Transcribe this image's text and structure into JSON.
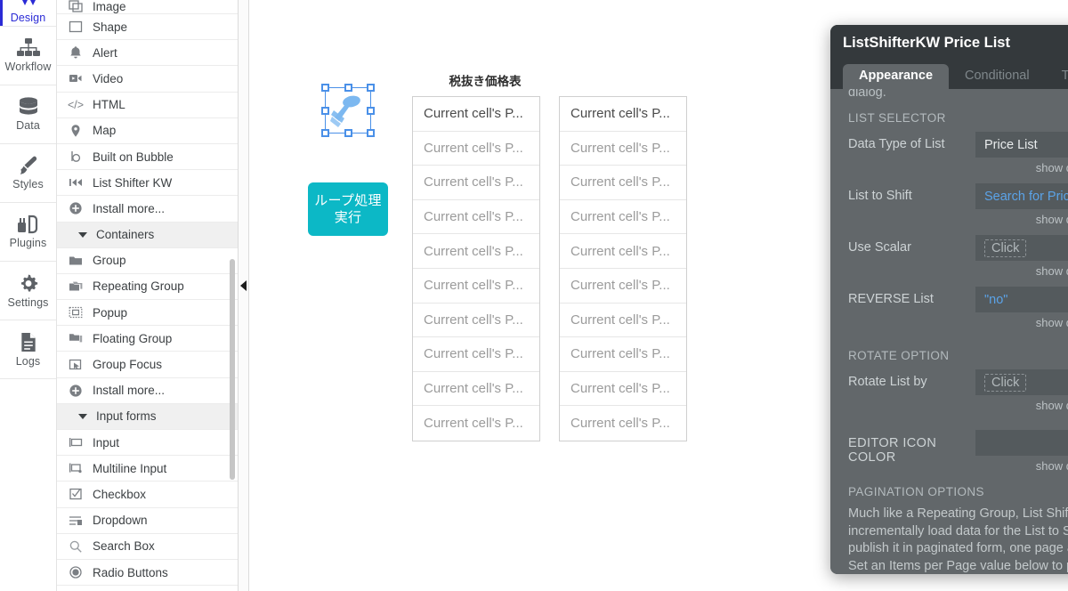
{
  "rail": {
    "items": [
      {
        "label": "Design",
        "icon": "design-icon",
        "active": true
      },
      {
        "label": "Workflow",
        "icon": "workflow-icon",
        "active": false
      },
      {
        "label": "Data",
        "icon": "database-icon",
        "active": false
      },
      {
        "label": "Styles",
        "icon": "brush-icon",
        "active": false
      },
      {
        "label": "Plugins",
        "icon": "plugins-icon",
        "active": false
      },
      {
        "label": "Settings",
        "icon": "gear-icon",
        "active": false
      },
      {
        "label": "Logs",
        "icon": "document-icon",
        "active": false
      }
    ]
  },
  "palette": {
    "items": [
      {
        "label": "Image",
        "icon": "image-icon",
        "type": "item"
      },
      {
        "label": "Shape",
        "icon": "shape-icon",
        "type": "item"
      },
      {
        "label": "Alert",
        "icon": "bell-icon",
        "type": "item"
      },
      {
        "label": "Video",
        "icon": "video-icon",
        "type": "item"
      },
      {
        "label": "HTML",
        "icon": "code-icon",
        "type": "item"
      },
      {
        "label": "Map",
        "icon": "map-pin-icon",
        "type": "item"
      },
      {
        "label": "Built on Bubble",
        "icon": "bubble-b-icon",
        "type": "item"
      },
      {
        "label": "List Shifter KW",
        "icon": "skip-backward-icon",
        "type": "item"
      },
      {
        "label": "Install more...",
        "icon": "plus-circle-icon",
        "type": "item"
      },
      {
        "label": "Containers",
        "icon": "caret-down-icon",
        "type": "section"
      },
      {
        "label": "Group",
        "icon": "folder-icon",
        "type": "item"
      },
      {
        "label": "Repeating Group",
        "icon": "repeating-group-icon",
        "type": "item"
      },
      {
        "label": "Popup",
        "icon": "popup-icon",
        "type": "item"
      },
      {
        "label": "Floating Group",
        "icon": "floating-group-icon",
        "type": "item"
      },
      {
        "label": "Group Focus",
        "icon": "group-focus-icon",
        "type": "item"
      },
      {
        "label": "Install more...",
        "icon": "plus-circle-icon",
        "type": "item"
      },
      {
        "label": "Input forms",
        "icon": "caret-down-icon",
        "type": "section"
      },
      {
        "label": "Input",
        "icon": "input-icon",
        "type": "item"
      },
      {
        "label": "Multiline Input",
        "icon": "multiline-input-icon",
        "type": "item"
      },
      {
        "label": "Checkbox",
        "icon": "checkbox-icon",
        "type": "item"
      },
      {
        "label": "Dropdown",
        "icon": "dropdown-icon",
        "type": "item"
      },
      {
        "label": "Search Box",
        "icon": "search-icon",
        "type": "item"
      },
      {
        "label": "Radio Buttons",
        "icon": "radio-icon",
        "type": "item"
      }
    ]
  },
  "canvas": {
    "selected_element_icon": "list-shifter-kw-element-icon",
    "loop_button": {
      "line1": "ループ処理",
      "line2": "実行",
      "color": "#0cb8c6"
    },
    "repeating_group_title": "税抜き価格表",
    "cell_text": "Current cell's P...",
    "cell_count": 10,
    "second_group_cell_text": "C"
  },
  "dialog": {
    "title": "ListShifterKW Price List",
    "header_actions": [
      {
        "name": "info-icon",
        "glyph": "info"
      },
      {
        "name": "comment-icon",
        "glyph": "comment"
      },
      {
        "name": "close-icon",
        "glyph": "close"
      }
    ],
    "tabs": [
      {
        "label": "Appearance",
        "active": true
      },
      {
        "label": "Conditional",
        "active": false
      },
      {
        "label": "Transitions",
        "active": false
      }
    ],
    "clipped_text": "dialog.",
    "sections": [
      {
        "heading": "LIST SELECTOR",
        "rows": [
          {
            "label": "Data Type of List",
            "value": "Price List",
            "style": "dropdown",
            "doc": "show documentation"
          },
          {
            "label": "List to Shift",
            "value": "Search for Price Lists",
            "style": "link",
            "doc": "show documentation"
          },
          {
            "label": "Use Scalar",
            "value": "Click",
            "style": "click",
            "doc": "show documentation"
          },
          {
            "label": "REVERSE List",
            "value": "\"no\"",
            "style": "blueval",
            "doc": "show documentation"
          }
        ]
      },
      {
        "heading": "ROTATE OPTION",
        "rows": [
          {
            "label": "Rotate List by",
            "value": "Click",
            "style": "click",
            "doc": "show documentation"
          }
        ]
      },
      {
        "heading": "EDITOR ICON COLOR",
        "inline_dropdown": true,
        "rows": [],
        "doc": "show documentation"
      },
      {
        "heading": "PAGINATION OPTIONS",
        "paragraph": "Much like a Repeating Group, List Shifter can incrementally load data for the List to Shift and publish it in paginated form, one page at a time. Set an Items per Page value below to put List Shifter into",
        "rows": []
      }
    ]
  }
}
